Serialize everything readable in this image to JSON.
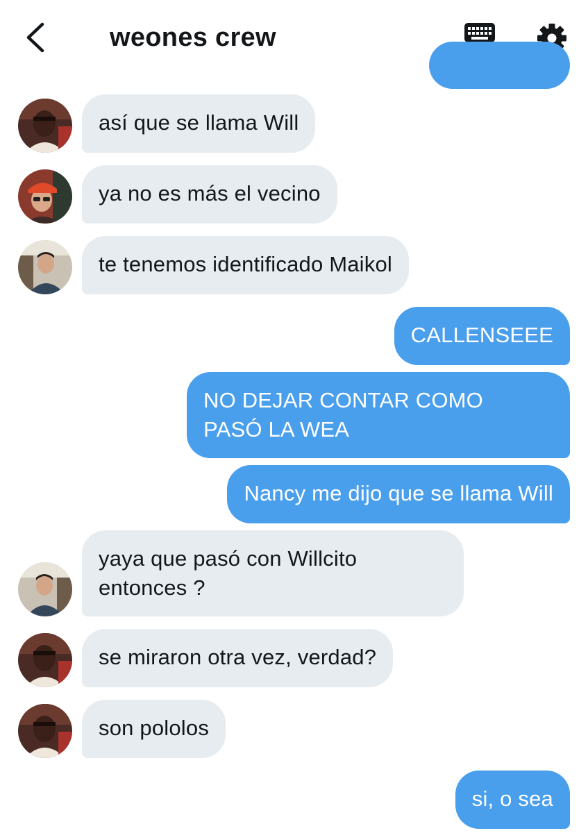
{
  "header": {
    "title": "weones crew"
  },
  "icons": {
    "back": "chevron-left-icon",
    "keyboard": "keyboard-icon",
    "settings": "gear-icon"
  },
  "colors": {
    "incoming_bubble": "#e6ecf0",
    "outgoing_bubble": "#4a9fec",
    "text": "#14171a"
  },
  "messages": [
    {
      "direction": "outgoing",
      "text": ""
    },
    {
      "direction": "incoming",
      "sender": "avatar-1",
      "text": "así que se llama Will"
    },
    {
      "direction": "incoming",
      "sender": "avatar-2",
      "text": "ya no es más el vecino"
    },
    {
      "direction": "incoming",
      "sender": "avatar-3",
      "text": "te tenemos identificado Maikol"
    },
    {
      "direction": "outgoing",
      "text": "CALLENSEEE"
    },
    {
      "direction": "outgoing",
      "lines": [
        "NO DEJAR CONTAR COMO",
        "PASÓ LA WEA"
      ]
    },
    {
      "direction": "outgoing",
      "text": "Nancy me dijo que se llama Will"
    },
    {
      "direction": "incoming",
      "sender": "avatar-3",
      "lines": [
        "yaya que pasó con Willcito",
        "entonces ?"
      ]
    },
    {
      "direction": "incoming",
      "sender": "avatar-1",
      "text": "se miraron otra vez, verdad?"
    },
    {
      "direction": "incoming",
      "sender": "avatar-1",
      "text": "son pololos"
    },
    {
      "direction": "outgoing",
      "text": "si, o sea"
    }
  ]
}
